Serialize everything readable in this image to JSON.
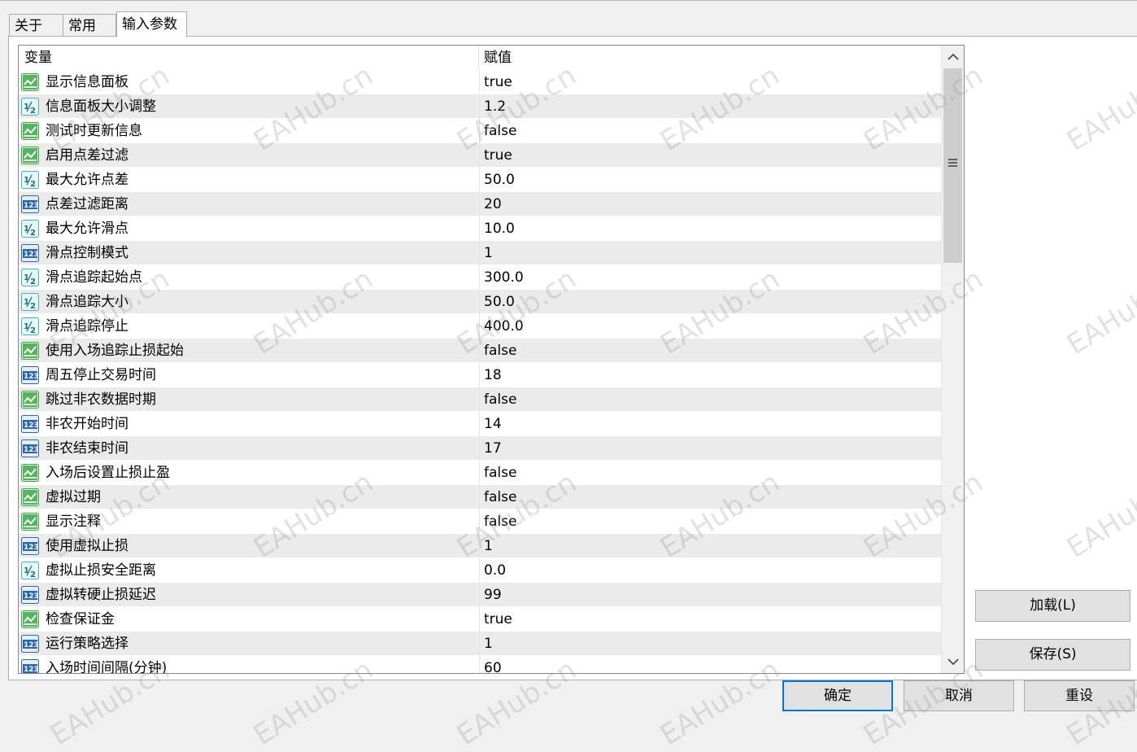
{
  "tabs": [
    {
      "label": "关于",
      "active": false
    },
    {
      "label": "常用",
      "active": false
    },
    {
      "label": "输入参数",
      "active": true
    }
  ],
  "grid": {
    "columns": {
      "variable": "变量",
      "value": "赋值"
    },
    "rows": [
      {
        "icon": "bool-icon",
        "name": "显示信息面板",
        "value": "true"
      },
      {
        "icon": "double-icon",
        "name": "信息面板大小调整",
        "value": "1.2"
      },
      {
        "icon": "bool-icon",
        "name": "测试时更新信息",
        "value": "false"
      },
      {
        "icon": "bool-icon",
        "name": "启用点差过滤",
        "value": "true"
      },
      {
        "icon": "double-icon",
        "name": "最大允许点差",
        "value": "50.0"
      },
      {
        "icon": "int-icon",
        "name": "点差过滤距离",
        "value": "20"
      },
      {
        "icon": "double-icon",
        "name": "最大允许滑点",
        "value": "10.0"
      },
      {
        "icon": "int-icon",
        "name": "滑点控制模式",
        "value": "1"
      },
      {
        "icon": "double-icon",
        "name": "滑点追踪起始点",
        "value": "300.0"
      },
      {
        "icon": "double-icon",
        "name": "滑点追踪大小",
        "value": "50.0"
      },
      {
        "icon": "double-icon",
        "name": "滑点追踪停止",
        "value": "400.0"
      },
      {
        "icon": "bool-icon",
        "name": "使用入场追踪止损起始",
        "value": "false"
      },
      {
        "icon": "int-icon",
        "name": "周五停止交易时间",
        "value": "18"
      },
      {
        "icon": "bool-icon",
        "name": "跳过非农数据时期",
        "value": "false"
      },
      {
        "icon": "int-icon",
        "name": "非农开始时间",
        "value": "14"
      },
      {
        "icon": "int-icon",
        "name": "非农结束时间",
        "value": "17"
      },
      {
        "icon": "bool-icon",
        "name": "入场后设置止损止盈",
        "value": "false"
      },
      {
        "icon": "bool-icon",
        "name": "虚拟过期",
        "value": "false"
      },
      {
        "icon": "bool-icon",
        "name": "显示注释",
        "value": "false"
      },
      {
        "icon": "int-icon",
        "name": "使用虚拟止损",
        "value": "1"
      },
      {
        "icon": "double-icon",
        "name": "虚拟止损安全距离",
        "value": "0.0"
      },
      {
        "icon": "int-icon",
        "name": "虚拟转硬止损延迟",
        "value": "99"
      },
      {
        "icon": "bool-icon",
        "name": "检查保证金",
        "value": "true"
      },
      {
        "icon": "int-icon",
        "name": "运行策略选择",
        "value": "1"
      },
      {
        "icon": "int-icon",
        "name": "入场时间间隔(分钟)",
        "value": "60"
      }
    ]
  },
  "buttons": {
    "load": "加载(L)",
    "save": "保存(S)",
    "ok": "确定",
    "cancel": "取消",
    "reset": "重设"
  },
  "watermark": "EAHub.cn",
  "colors": {
    "bool_icon": "#3aa845",
    "double_icon": "#3bb7c9",
    "int_icon": "#2b66b4",
    "row_alt": "#ebebeb",
    "default_button_border": "#0078d7"
  }
}
